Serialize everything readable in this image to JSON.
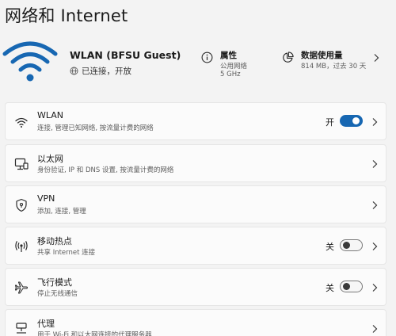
{
  "page": {
    "title": "网络和 Internet"
  },
  "network": {
    "name": "WLAN (BFSU Guest)",
    "status": "已连接，开放"
  },
  "properties": {
    "title": "属性",
    "line1": "公用网络",
    "line2": "5 GHz"
  },
  "data_usage": {
    "title": "数据使用量",
    "line1": "814 MB，过去 30 天"
  },
  "settings": [
    {
      "title": "WLAN",
      "desc": "连接, 管理已知网络, 按流量计费的网络",
      "icon": "wifi-icon",
      "toggle_label": "开",
      "toggle_on": true
    },
    {
      "title": "以太网",
      "desc": "身份验证, IP 和 DNS 设置, 按流量计费的网络",
      "icon": "ethernet-icon"
    },
    {
      "title": "VPN",
      "desc": "添加, 连接, 管理",
      "icon": "vpn-shield-icon"
    },
    {
      "title": "移动热点",
      "desc": "共享 Internet 连接",
      "icon": "hotspot-icon",
      "toggle_label": "关",
      "toggle_on": false
    },
    {
      "title": "飞行模式",
      "desc": "停止无线通信",
      "icon": "airplane-icon",
      "toggle_label": "关",
      "toggle_on": false
    },
    {
      "title": "代理",
      "desc": "用于 Wi-Fi 和以太网连接的代理服务器",
      "icon": "proxy-icon"
    }
  ],
  "colors": {
    "accent": "#1767b2",
    "background": "#f3f3f3",
    "card": "#fbfbfb"
  }
}
